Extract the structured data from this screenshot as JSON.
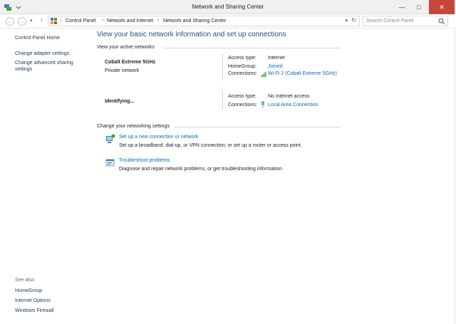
{
  "window": {
    "title": "Network and Sharing Center"
  },
  "address": {
    "crumbs": [
      "Control Panel",
      "Network and Internet",
      "Network and Sharing Center"
    ],
    "search_placeholder": "Search Control Panel"
  },
  "sidebar": {
    "links": [
      "Control Panel Home",
      "Change adapter settings",
      "Change advanced sharing settings"
    ],
    "see_also_title": "See also",
    "see_also": [
      "HomeGroup",
      "Internet Options",
      "Windows Firewall"
    ]
  },
  "main": {
    "heading": "View your basic network information and set up connections",
    "active_title": "View your active networks",
    "networks": [
      {
        "name": "Cobalt Extreme 5GHz",
        "category": "Private network",
        "access_label": "Access type:",
        "access_value": "Internet",
        "homegroup_label": "HomeGroup:",
        "homegroup_value": "Joined",
        "connections_label": "Connections:",
        "connection": "Wi-Fi 2 (Cobalt Extreme 5GHz)",
        "connection_icon": "wifi-signal-icon"
      },
      {
        "name": "Identifying...",
        "access_label": "Access type:",
        "access_value": "No Internet access",
        "connections_label": "Connections:",
        "connection": "Local Area Connection",
        "connection_icon": "ethernet-icon"
      }
    ],
    "settings_title": "Change your networking settings",
    "tasks": [
      {
        "link": "Set up a new connection or network",
        "desc": "Set up a broadband, dial-up, or VPN connection; or set up a router or access point.",
        "icon": "new-connection-icon"
      },
      {
        "link": "Troubleshoot problems",
        "desc": "Diagnose and repair network problems, or get troubleshooting information.",
        "icon": "troubleshoot-icon"
      }
    ]
  },
  "colors": {
    "link": "#0066cc",
    "heading": "#1c5180",
    "close": "#c7463c"
  }
}
